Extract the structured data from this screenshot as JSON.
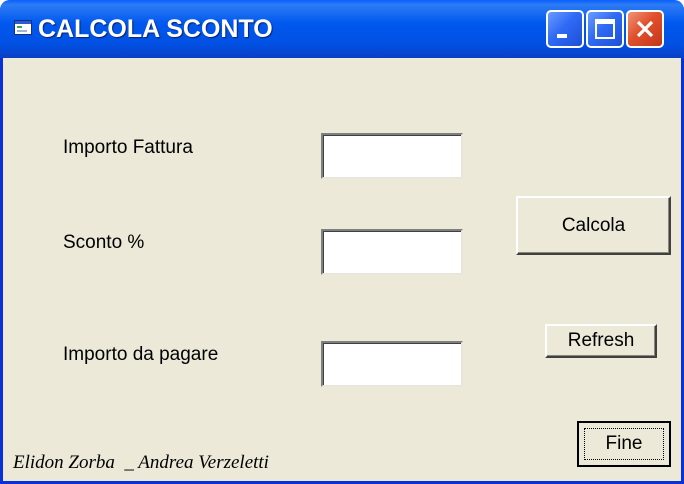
{
  "window": {
    "title": "CALCOLA SCONTO",
    "icons": {
      "app": "app-form-icon",
      "minimize": "minimize-icon",
      "maximize": "maximize-icon",
      "close": "close-icon"
    },
    "colors": {
      "titlebar": "#0058ee",
      "close_button": "#e0502d",
      "window_bg": "#ece9d8"
    }
  },
  "form": {
    "importo_fattura": {
      "label": "Importo Fattura",
      "value": ""
    },
    "sconto": {
      "label": "Sconto %",
      "value": ""
    },
    "importo_da_pagare": {
      "label": "Importo da pagare",
      "value": ""
    }
  },
  "buttons": {
    "calcola": "Calcola",
    "refresh": "Refresh",
    "fine": "Fine"
  },
  "footer": {
    "authors": "Elidon Zorba  _ Andrea Verzeletti"
  }
}
